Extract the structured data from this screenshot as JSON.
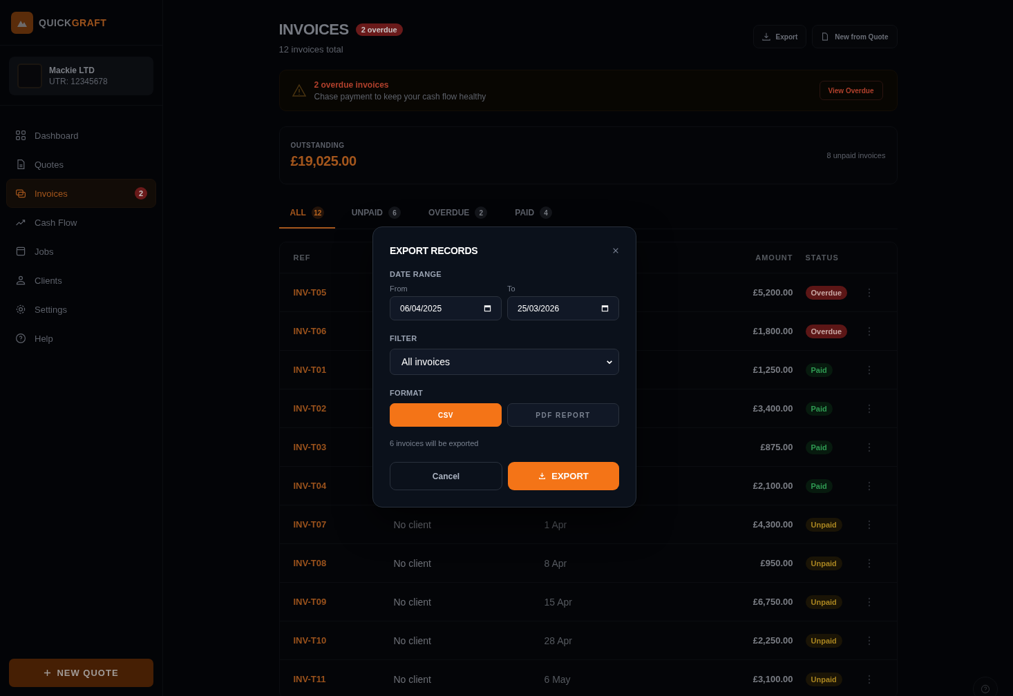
{
  "brand": {
    "first": "QUICK",
    "second": "GRAFT"
  },
  "account": {
    "name": "Mackie LTD",
    "utr": "UTR: 12345678"
  },
  "nav": [
    {
      "label": "Dashboard",
      "selected": false
    },
    {
      "label": "Quotes",
      "selected": false
    },
    {
      "label": "Invoices",
      "selected": true,
      "badge": "2"
    },
    {
      "label": "Cash Flow",
      "selected": false
    },
    {
      "label": "Jobs",
      "selected": false
    },
    {
      "label": "Clients",
      "selected": false
    },
    {
      "label": "Settings",
      "selected": false
    },
    {
      "label": "Help",
      "selected": false
    }
  ],
  "new_quote_button": "NEW QUOTE",
  "header": {
    "title": "INVOICES",
    "badge": "2 overdue",
    "subtitle": "12 invoices total",
    "buttons": [
      "Export",
      "New from Quote"
    ]
  },
  "alert": {
    "title": "2 overdue invoices",
    "text": "Chase payment to keep your cash flow healthy",
    "button": "View Overdue"
  },
  "summary": {
    "label": "OUTSTANDING",
    "amount": "£19,025.00",
    "note": "8 unpaid invoices"
  },
  "tabs": [
    {
      "label": "ALL",
      "count": "12",
      "selected": true
    },
    {
      "label": "UNPAID",
      "count": "6",
      "selected": false
    },
    {
      "label": "OVERDUE",
      "count": "2",
      "selected": false
    },
    {
      "label": "PAID",
      "count": "4",
      "selected": false
    }
  ],
  "table": {
    "columns": {
      "ref": "REF",
      "amount": "AMOUNT",
      "status": "STATUS"
    },
    "rows": [
      {
        "ref": "INV-T05",
        "amount": "£5,200.00",
        "status": "Overdue",
        "kind": "overdue"
      },
      {
        "ref": "INV-T06",
        "amount": "£1,800.00",
        "status": "Overdue",
        "kind": "overdue"
      },
      {
        "ref": "INV-T01",
        "amount": "£1,250.00",
        "status": "Paid",
        "kind": "paid"
      },
      {
        "ref": "INV-T02",
        "amount": "£3,400.00",
        "status": "Paid",
        "kind": "paid"
      },
      {
        "ref": "INV-T03",
        "amount": "£875.00",
        "status": "Paid",
        "kind": "paid"
      },
      {
        "ref": "INV-T04",
        "amount": "£2,100.00",
        "status": "Paid",
        "kind": "paid"
      },
      {
        "ref": "INV-T07",
        "client": "No client",
        "date": "1 Apr",
        "amount": "£4,300.00",
        "status": "Unpaid",
        "kind": "unpaid"
      },
      {
        "ref": "INV-T08",
        "client": "No client",
        "date": "8 Apr",
        "amount": "£950.00",
        "status": "Unpaid",
        "kind": "unpaid"
      },
      {
        "ref": "INV-T09",
        "client": "No client",
        "date": "15 Apr",
        "amount": "£6,750.00",
        "status": "Unpaid",
        "kind": "unpaid"
      },
      {
        "ref": "INV-T10",
        "client": "No client",
        "date": "28 Apr",
        "amount": "£2,250.00",
        "status": "Unpaid",
        "kind": "unpaid"
      },
      {
        "ref": "INV-T11",
        "client": "No client",
        "date": "6 May",
        "amount": "£3,100.00",
        "status": "Unpaid",
        "kind": "unpaid"
      }
    ]
  },
  "modal": {
    "title": "EXPORT RECORDS",
    "date_range_label": "DATE RANGE",
    "from_label": "From",
    "from_value": "06/04/2025",
    "to_label": "To",
    "to_value": "25/03/2026",
    "filter_label": "FILTER",
    "filter_value": "All invoices",
    "format_label": "FORMAT",
    "formats": [
      {
        "label": "CSV",
        "selected": true
      },
      {
        "label": "PDF REPORT",
        "selected": false
      }
    ],
    "note": "6 invoices will be exported",
    "cancel": "Cancel",
    "export": "EXPORT"
  }
}
